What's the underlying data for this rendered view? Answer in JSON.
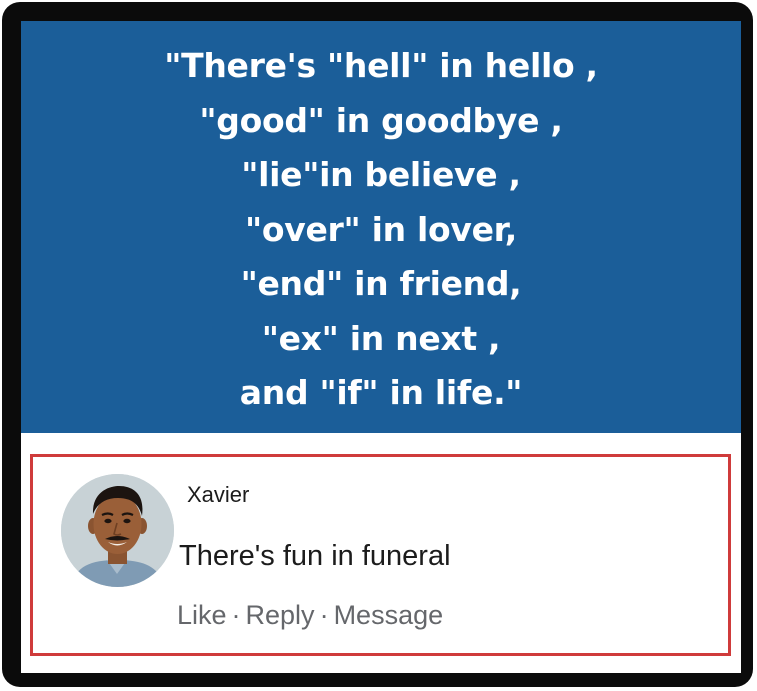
{
  "quote": {
    "lines": [
      "\"There's \"hell\" in hello ,",
      "\"good\" in goodbye ,",
      "\"lie\"in believe ,",
      "\"over\" in lover,",
      "\"end\" in friend,",
      "\"ex\" in next ,",
      "and \"if\" in life.\""
    ],
    "background_color": "#1b5e99",
    "text_color": "#ffffff"
  },
  "comment": {
    "author": "Xavier",
    "text": "There's fun in funeral",
    "actions": {
      "like": "Like",
      "reply": "Reply",
      "message": "Message",
      "separator": "·"
    },
    "highlight_color": "#cf3b3b"
  },
  "icons": {
    "avatar": "person-avatar-icon"
  }
}
